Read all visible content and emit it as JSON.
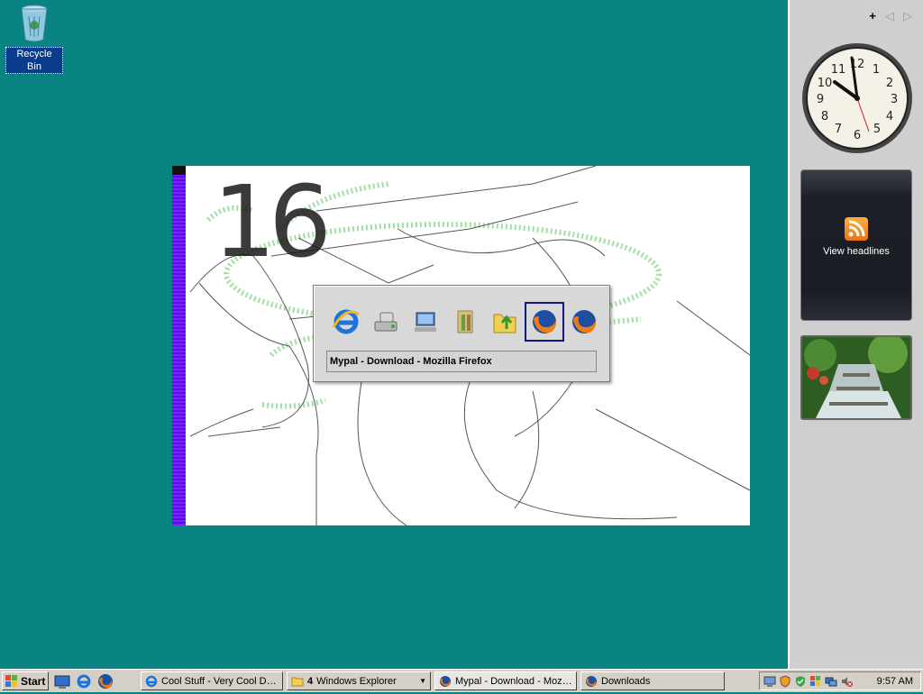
{
  "desktop": {
    "recycle_bin_label": "Recycle Bin",
    "background_color": "#0a8383"
  },
  "canvas": {
    "handwritten_text": "16"
  },
  "switcher": {
    "selected_title": "Mypal - Download - Mozilla Firefox",
    "icons": [
      "internet-explorer-icon",
      "drive-icon",
      "network-icon",
      "folder-files-icon",
      "folder-up-icon",
      "firefox-icon",
      "firefox-icon"
    ],
    "selected_index": 5
  },
  "sidebar": {
    "add_symbol": "+",
    "prev_symbol": "◁",
    "next_symbol": "▷",
    "feed_label": "View headlines",
    "clock_time": "9:57"
  },
  "taskbar": {
    "start_label": "Start",
    "quick_launch": [
      "show-desktop-icon",
      "internet-explorer-icon",
      "firefox-icon"
    ],
    "tasks": [
      {
        "label": "Cool Stuff - Very Cool Do...",
        "icon": "internet-explorer-icon"
      },
      {
        "count": "4",
        "label": "Windows Explorer",
        "icon": "folder-icon"
      },
      {
        "label": "Mypal - Download - Mozill...",
        "icon": "firefox-icon"
      },
      {
        "label": "Downloads",
        "icon": "firefox-icon"
      }
    ],
    "clock": "9:57 AM"
  }
}
